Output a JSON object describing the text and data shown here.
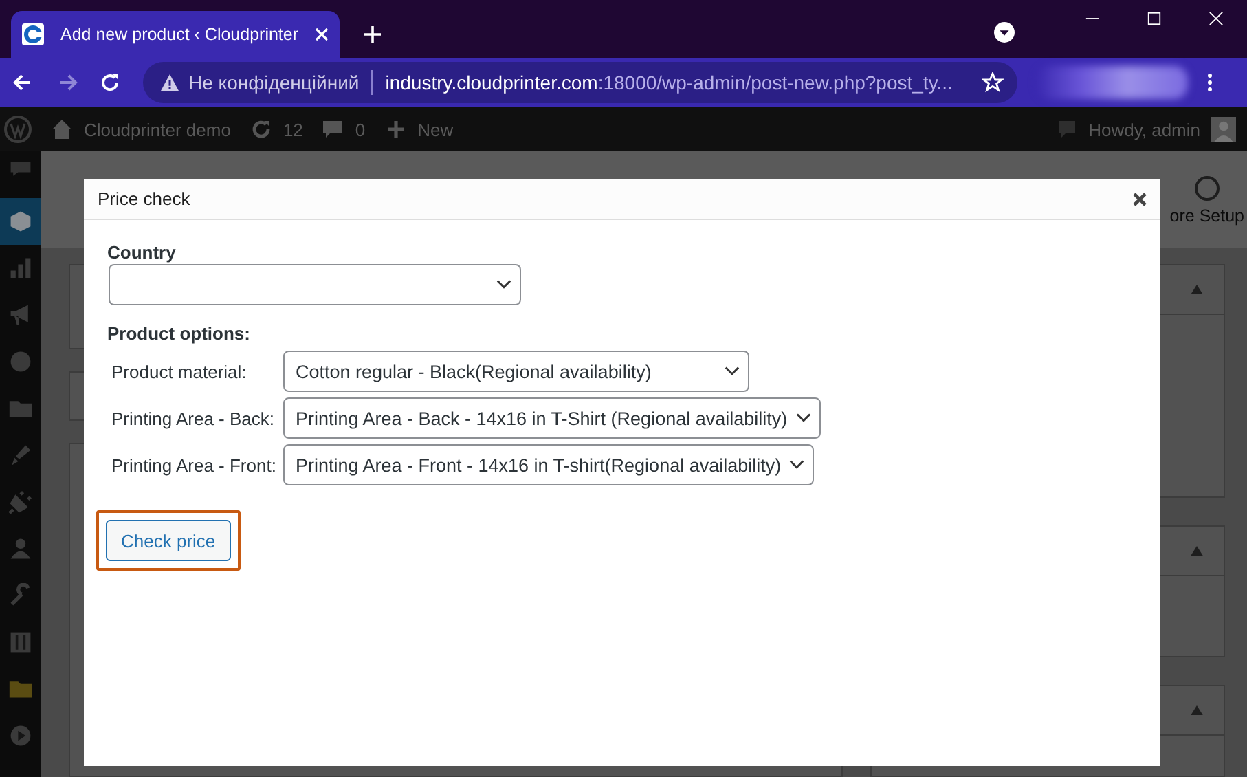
{
  "browser": {
    "tab_title": "Add new product ‹ Cloudprinter",
    "security": "Не конфіденційний",
    "url_host": "industry.cloudprinter.com",
    "url_rest": ":18000/wp-admin/post-new.php?post_ty..."
  },
  "admin_bar": {
    "site": "Cloudprinter demo",
    "updates": "12",
    "comments": "0",
    "new": "New",
    "greeting": "Howdy, admin"
  },
  "background": {
    "setup": "ore Setup"
  },
  "dialog": {
    "title": "Price check",
    "country_label": "Country",
    "options_heading": "Product options:",
    "options": [
      {
        "label": "Product material:",
        "value": "Cotton regular - Black(Regional availability)"
      },
      {
        "label": "Printing Area - Back:",
        "value": "Printing Area - Back - 14x16 in T-Shirt (Regional availability)"
      },
      {
        "label": "Printing Area - Front:",
        "value": "Printing Area - Front - 14x16 in T-shirt(Regional availability)"
      }
    ],
    "button": {
      "label": "Check price",
      "highlighted": true
    }
  }
}
